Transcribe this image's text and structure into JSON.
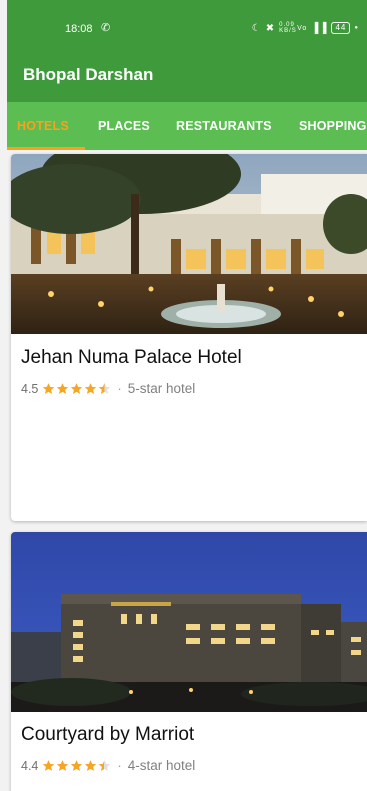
{
  "status_bar": {
    "time": "18:08",
    "call_icon": "phone-icon",
    "icons": [
      "moon-icon",
      "mute-icon",
      "data-speed-icon",
      "volte-icon",
      "signal-icon",
      "battery-icon"
    ],
    "data_speed": "0.09 KB/S",
    "battery": "44"
  },
  "app_bar": {
    "title": "Bhopal Darshan"
  },
  "tabs": [
    {
      "label": "HOTELS",
      "active": true
    },
    {
      "label": "PLACES",
      "active": false
    },
    {
      "label": "RESTAURANTS",
      "active": false
    },
    {
      "label": "SHOPPING",
      "active": false
    }
  ],
  "colors": {
    "app_bar": "#3f9a3b",
    "tab_bar": "#5bbd52",
    "accent": "#ff9f1a",
    "star": "#f5a623"
  },
  "hotels": [
    {
      "name": "Jehan Numa Palace Hotel",
      "rating": "4.5",
      "stars": 4.5,
      "separator": "·",
      "category": "5-star hotel"
    },
    {
      "name": "Courtyard by Marriot",
      "rating": "4.4",
      "stars": 4.4,
      "separator": "·",
      "category": "4-star hotel"
    }
  ]
}
